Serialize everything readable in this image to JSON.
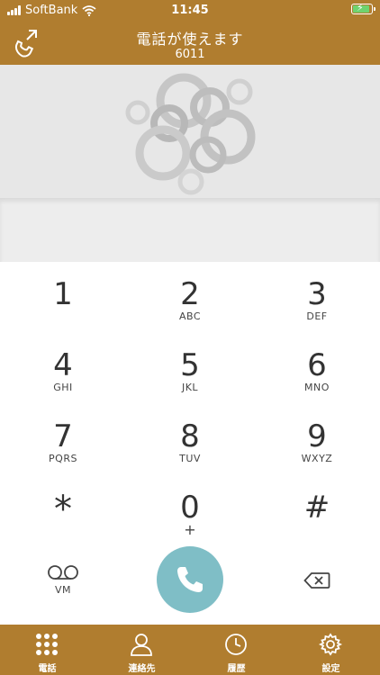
{
  "status_bar": {
    "carrier": "SoftBank",
    "time": "11:45"
  },
  "header": {
    "title": "電話が使えます",
    "extension": "6011"
  },
  "dialer": {
    "number": ""
  },
  "keypad": {
    "keys": [
      {
        "digit": "1",
        "letters": ""
      },
      {
        "digit": "2",
        "letters": "ABC"
      },
      {
        "digit": "3",
        "letters": "DEF"
      },
      {
        "digit": "4",
        "letters": "GHI"
      },
      {
        "digit": "5",
        "letters": "JKL"
      },
      {
        "digit": "6",
        "letters": "MNO"
      },
      {
        "digit": "7",
        "letters": "PQRS"
      },
      {
        "digit": "8",
        "letters": "TUV"
      },
      {
        "digit": "9",
        "letters": "WXYZ"
      },
      {
        "digit": "*",
        "letters": ""
      },
      {
        "digit": "0",
        "letters": "+"
      },
      {
        "digit": "#",
        "letters": ""
      }
    ],
    "voicemail_label": "VM"
  },
  "tabs": [
    {
      "label": "電話",
      "icon": "keypad-grid-icon"
    },
    {
      "label": "連絡先",
      "icon": "person-icon"
    },
    {
      "label": "履歴",
      "icon": "clock-icon"
    },
    {
      "label": "設定",
      "icon": "gear-icon"
    }
  ],
  "colors": {
    "brand": "#b07d2f",
    "call_button": "#7fbec6"
  }
}
